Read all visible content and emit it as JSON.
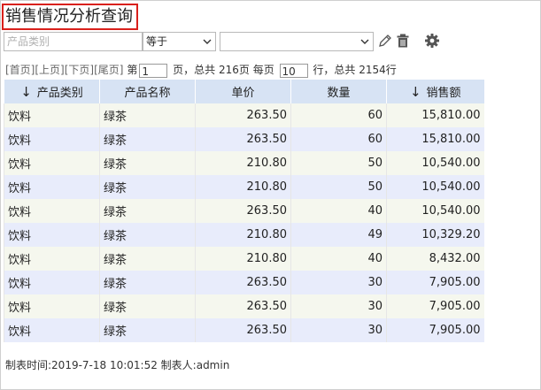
{
  "report": {
    "title": "销售情况分析查询"
  },
  "filter": {
    "field_placeholder": "产品类别",
    "operator": "等于",
    "value": ""
  },
  "icons": {
    "edit": "pencil-icon",
    "delete": "trash-icon",
    "settings": "gear-icon",
    "sort": "arrow-down"
  },
  "pager": {
    "first": "[首页]",
    "prev": "[上页]",
    "next": "[下页]",
    "last": "[尾页]",
    "page_prefix": "第",
    "current_page": "1",
    "page_suffix": "页，总共 216页 每页",
    "page_size": "10",
    "rows_suffix": "行，总共 2154行"
  },
  "table": {
    "columns": [
      "产品类别",
      "产品名称",
      "单价",
      "数量",
      "销售额"
    ],
    "rows": [
      [
        "饮料",
        "绿茶",
        "263.50",
        "60",
        "15,810.00"
      ],
      [
        "饮料",
        "绿茶",
        "263.50",
        "60",
        "15,810.00"
      ],
      [
        "饮料",
        "绿茶",
        "210.80",
        "50",
        "10,540.00"
      ],
      [
        "饮料",
        "绿茶",
        "210.80",
        "50",
        "10,540.00"
      ],
      [
        "饮料",
        "绿茶",
        "263.50",
        "40",
        "10,540.00"
      ],
      [
        "饮料",
        "绿茶",
        "210.80",
        "49",
        "10,329.20"
      ],
      [
        "饮料",
        "绿茶",
        "210.80",
        "40",
        "8,432.00"
      ],
      [
        "饮料",
        "绿茶",
        "263.50",
        "30",
        "7,905.00"
      ],
      [
        "饮料",
        "绿茶",
        "263.50",
        "30",
        "7,905.00"
      ],
      [
        "饮料",
        "绿茶",
        "263.50",
        "30",
        "7,905.00"
      ]
    ]
  },
  "footer": {
    "text": "制表时间:2019-7-18 10:01:52 制表人:admin"
  },
  "colors": {
    "header_bg": "#d7e3f4",
    "row_odd": "#f5f7ee",
    "row_even": "#e8ecfb",
    "title_border": "#d9201b"
  }
}
